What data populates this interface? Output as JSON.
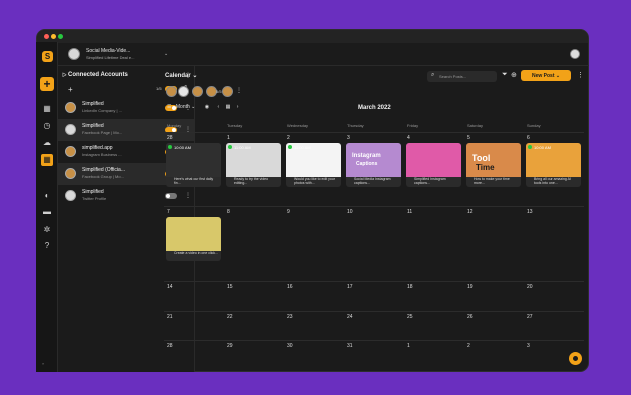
{
  "topbar": {
    "workspace_name": "Social Media-Vide...",
    "workspace_plan": "Simplified Lifetime Deal e..."
  },
  "accounts_panel": {
    "title": "Connected Accounts",
    "count": "1/5",
    "accounts": [
      {
        "name": "Simplified",
        "subtitle": "LinkedIn Company | ...",
        "enabled": true
      },
      {
        "name": "Simplified",
        "subtitle": "Facebook Page | Mo...",
        "enabled": true
      },
      {
        "name": "simplified.app",
        "subtitle": "Instagram Business ...",
        "enabled": true
      },
      {
        "name": "Simplified (Officia...",
        "subtitle": "Facebook Group | Mo...",
        "enabled": true
      },
      {
        "name": "Simplified",
        "subtitle": "Twitter Profile",
        "enabled": false
      }
    ]
  },
  "calendar": {
    "view_label": "Calendar",
    "chip_count": "5/5",
    "search_placeholder": "Search Posts...",
    "new_post_label": "New Post",
    "view_mode": "Month",
    "month_title": "March 2022",
    "day_names": [
      "Monday",
      "Tuesday",
      "Wednesday",
      "Thursday",
      "Friday",
      "Saturday",
      "Sunday"
    ],
    "weeks": [
      [
        "28",
        "1",
        "2",
        "3",
        "4",
        "5",
        "6"
      ],
      [
        "7",
        "8",
        "9",
        "10",
        "11",
        "12",
        "13"
      ],
      [
        "14",
        "15",
        "16",
        "17",
        "18",
        "19",
        "20"
      ],
      [
        "21",
        "22",
        "23",
        "24",
        "25",
        "26",
        "27"
      ],
      [
        "28",
        "29",
        "30",
        "31",
        "1",
        "2",
        "3"
      ]
    ],
    "posts": [
      {
        "time": "10:00 AM",
        "caption": "Here's what our first daily fin...",
        "bg": "#2f2f2f"
      },
      {
        "time": "11:00 AM",
        "caption": "Ready to try the video editing...",
        "bg": "#d9d9d9"
      },
      {
        "time": "11:00 AM",
        "caption": "Would you like to edit your photos with...",
        "bg": "#f4f4f4"
      },
      {
        "time": "",
        "caption": "Social Media Instagram captions...",
        "bg": "#b58ad0"
      },
      {
        "time": "",
        "caption": "Simplified Instagram captions...",
        "bg": "#e05aa8"
      },
      {
        "time": "",
        "caption": "How to make your time more...",
        "bg": "#d98a4a"
      },
      {
        "time": "10:00 AM",
        "caption": "Bring all our amazing AI tools into one...",
        "bg": "#e9a23b"
      },
      {
        "time": "",
        "caption": "Create a video in one click...",
        "bg": "#d8c86a"
      }
    ],
    "post_texts": [
      "Instagram",
      "Captions",
      "Tool",
      "Time"
    ]
  },
  "colors": {
    "accent": "#f2a218",
    "background": "#6a2fbf",
    "window": "#1b1b1b"
  }
}
